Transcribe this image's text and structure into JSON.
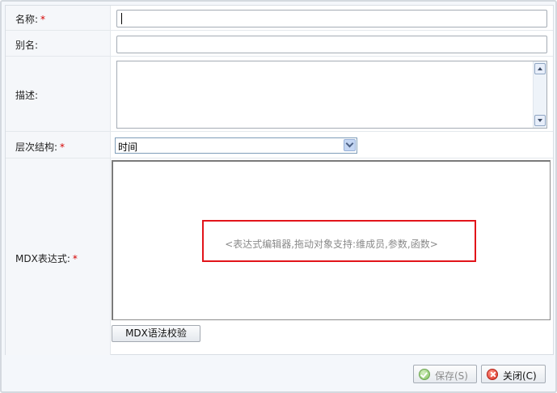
{
  "form": {
    "name_label": "名称:",
    "name_value": "",
    "alias_label": "别名:",
    "alias_value": "",
    "description_label": "描述:",
    "description_value": "",
    "hierarchy_label": "层次结构:",
    "hierarchy_value": "时间",
    "mdx_label": "MDX表达式:",
    "required_mark": "*",
    "mdx_placeholder": "<表达式编辑器,拖动对象支持:维成员,参数,函数>",
    "mdx_check_button": "MDX语法校验"
  },
  "footer": {
    "save_label": "保存(S)",
    "close_label": "关闭(C)"
  },
  "colors": {
    "required": "#d40000",
    "highlight": "#e2141a",
    "disabled_text": "#8c8c8c"
  },
  "icons": {
    "save": "check-icon",
    "close": "x-icon",
    "scroll_up": "arrow-up-icon",
    "scroll_down": "arrow-down-icon",
    "dropdown": "chevron-down-icon"
  }
}
